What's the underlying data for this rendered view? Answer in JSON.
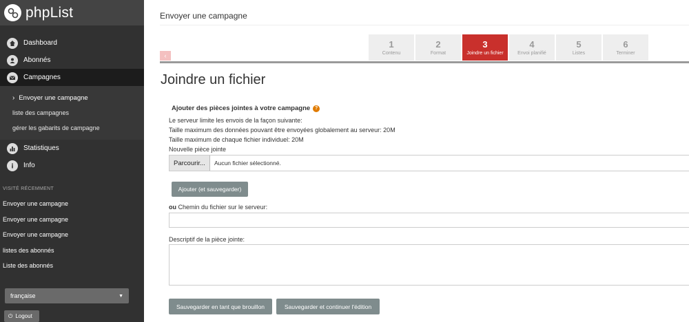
{
  "brand": {
    "name": "phpList"
  },
  "nav": {
    "items": [
      {
        "label": "Dashboard",
        "icon": "home-icon"
      },
      {
        "label": "Abonnés",
        "icon": "user-icon"
      },
      {
        "label": "Campagnes",
        "icon": "envelope-icon"
      }
    ],
    "sub": [
      {
        "label": "Envoyer une campagne",
        "current": true
      },
      {
        "label": "liste des campagnes"
      },
      {
        "label": "gérer les gabarits de campagne"
      }
    ],
    "items2": [
      {
        "label": "Statistiques",
        "icon": "stats-icon"
      },
      {
        "label": "Info",
        "icon": "info-icon"
      }
    ]
  },
  "recent": {
    "label": "VISITÉ RÉCEMMENT",
    "items": [
      "Envoyer une campagne",
      "Envoyer une campagne",
      "Envoyer une campagne",
      "listes des abonnés",
      "Liste des abonnés"
    ]
  },
  "language": {
    "selected": "française"
  },
  "logout": {
    "label": "Logout"
  },
  "header": {
    "title": "Envoyer une campagne"
  },
  "steps": [
    {
      "num": "1",
      "label": "Contenu"
    },
    {
      "num": "2",
      "label": "Format"
    },
    {
      "num": "3",
      "label": "Joindre un fichier",
      "active": true
    },
    {
      "num": "4",
      "label": "Envoi planifié"
    },
    {
      "num": "5",
      "label": "Listes"
    },
    {
      "num": "6",
      "label": "Terminer"
    }
  ],
  "page": {
    "title": "Joindre un fichier"
  },
  "form": {
    "section_title": "Ajouter des pièces jointes à votre campagne",
    "limit_line": "Le serveur limite les envois de la façon suivante:",
    "max_total": "Taille maximum des données pouvant être envoyées globalement au serveur: 20M",
    "max_file": "Taille maximum de chaque fichier individuel: 20M",
    "new_attachment": "Nouvelle pièce jointe",
    "browse_label": "Parcourir...",
    "no_file": "Aucun fichier sélectionné.",
    "add_button": "Ajouter (et sauvegarder)",
    "or_label": "ou",
    "path_label": "Chemin du fichier sur le serveur:",
    "desc_label": "Descriptif de la pièce jointe:",
    "save_draft": "Sauvegarder en tant que brouillon",
    "save_continue": "Sauvegarder et continuer l'édition"
  }
}
